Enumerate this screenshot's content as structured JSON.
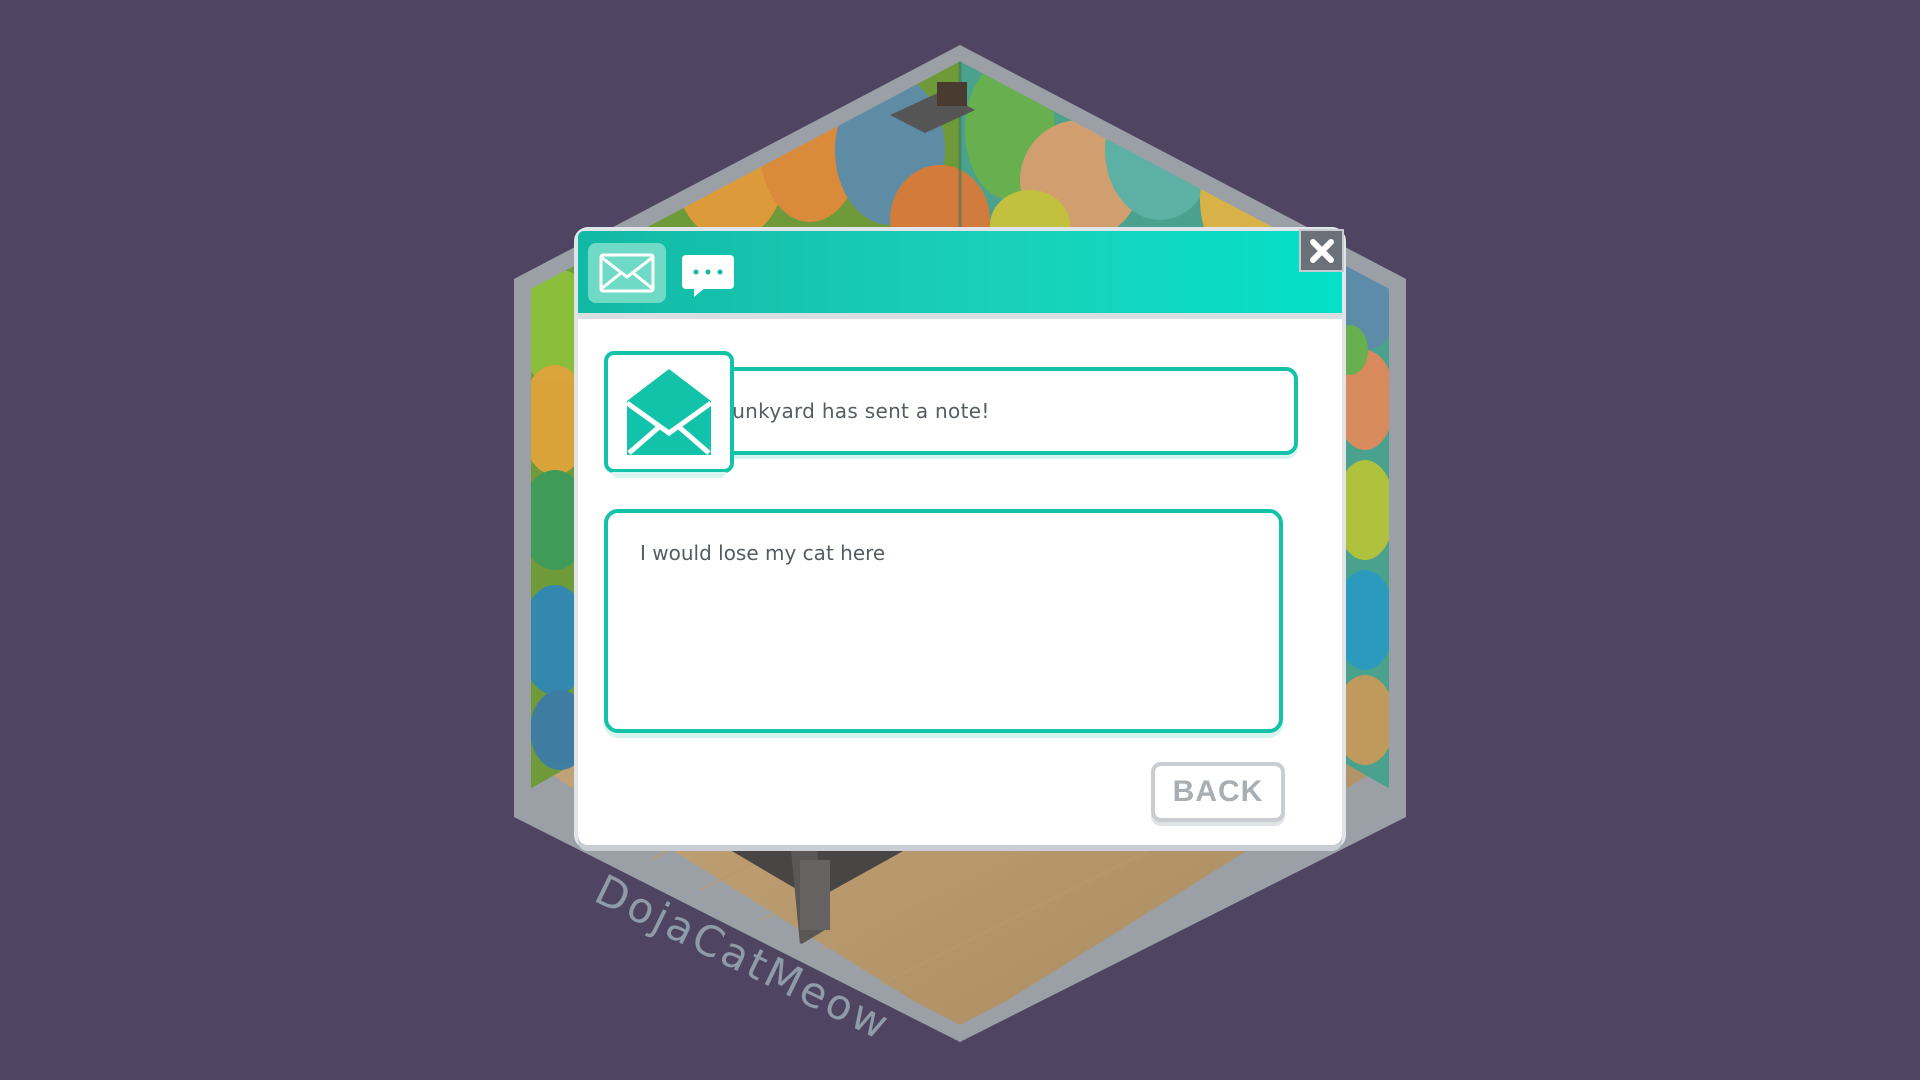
{
  "room": {
    "owner_name": "DojaCatMeow",
    "wallpaper": "cat-pattern-wallpaper",
    "floor": "light-wood-floor"
  },
  "dialog": {
    "tabs": [
      {
        "icon": "mail-icon",
        "selected": true
      },
      {
        "icon": "chat-bubble-icon",
        "selected": false
      }
    ],
    "close_icon": "close-icon",
    "note_icon": "open-envelope-icon",
    "note_title": "Junkyard has sent a note!",
    "message": "I would lose my cat here",
    "back_label": "BACK"
  },
  "colors": {
    "background": "#4f4563",
    "accent": "#12c3aa",
    "header_end": "#05e0c8",
    "frame": "#9aa0a6"
  }
}
